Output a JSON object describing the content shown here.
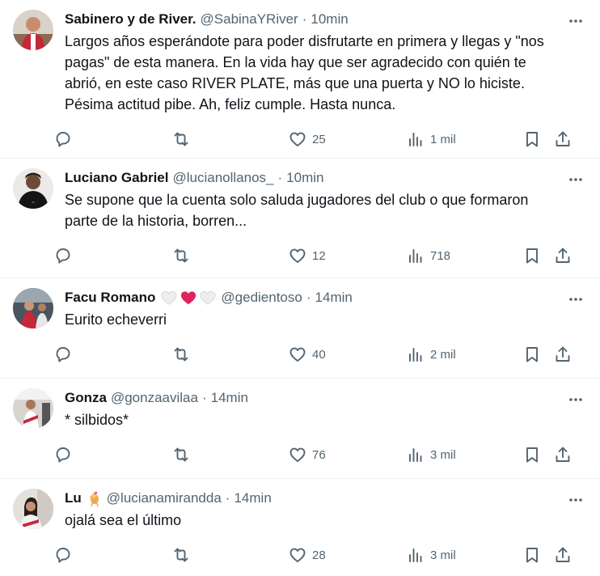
{
  "tweets": [
    {
      "name": "Sabinero y de River.",
      "handle": "@SabinaYRiver",
      "dot": "·",
      "time": "10min",
      "text": "Largos años esperándote para poder disfrutarte en primera y llegas y \"nos pagas\" de esta manera. En la vida hay que ser agradecido con quién te abrió, en este caso RIVER PLATE, más que una puerta y NO lo hiciste. Pésima actitud pibe. Ah, feliz cumple. Hasta nunca.",
      "likes": "25",
      "views": "1 mil"
    },
    {
      "name": "Luciano Gabriel",
      "handle": "@lucianollanos_",
      "dot": "·",
      "time": "10min",
      "text": "Se supone que la cuenta solo saluda jugadores del club o que formaron parte de la historia, borren...",
      "likes": "12",
      "views": "718"
    },
    {
      "name": "Facu Romano",
      "name_emoji": "🤍❤️🤍",
      "handle": "@gedientoso",
      "dot": "·",
      "time": "14min",
      "text": "Eurito echeverri",
      "likes": "40",
      "views": "2 mil"
    },
    {
      "name": "Gonza",
      "handle": "@gonzaavilaa",
      "dot": "·",
      "time": "14min",
      "text": "* silbidos*",
      "likes": "76",
      "views": "3 mil"
    },
    {
      "name": "Lu",
      "name_emoji": "🐓",
      "handle": "@lucianamirandda",
      "dot": "·",
      "time": "14min",
      "text": "ojalá sea el último",
      "likes": "28",
      "views": "3 mil"
    }
  ],
  "icons": {
    "reply": "reply-icon",
    "retweet": "retweet-icon",
    "like": "heart-icon",
    "views": "views-icon",
    "bookmark": "bookmark-icon",
    "share": "share-icon",
    "more": "more-icon"
  },
  "colors": {
    "text": "#0f1419",
    "secondary": "#536471",
    "border": "#eff3f4",
    "heart_red": "#e0245e"
  }
}
